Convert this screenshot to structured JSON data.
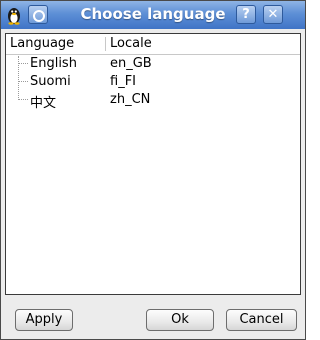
{
  "window": {
    "title": "Choose language",
    "help_glyph": "?",
    "close_glyph": "✕",
    "accent": "#3f74c6"
  },
  "icons": {
    "app": "penguin-icon",
    "menu": "ring-menu-icon",
    "help": "help-icon",
    "close": "close-icon"
  },
  "list": {
    "headers": {
      "language": "Language",
      "locale": "Locale"
    },
    "rows": [
      {
        "language": "English",
        "locale": "en_GB"
      },
      {
        "language": "Suomi",
        "locale": "fi_FI"
      },
      {
        "language": "中文",
        "locale": "zh_CN"
      }
    ]
  },
  "buttons": {
    "apply": "Apply",
    "ok": "Ok",
    "cancel": "Cancel"
  }
}
